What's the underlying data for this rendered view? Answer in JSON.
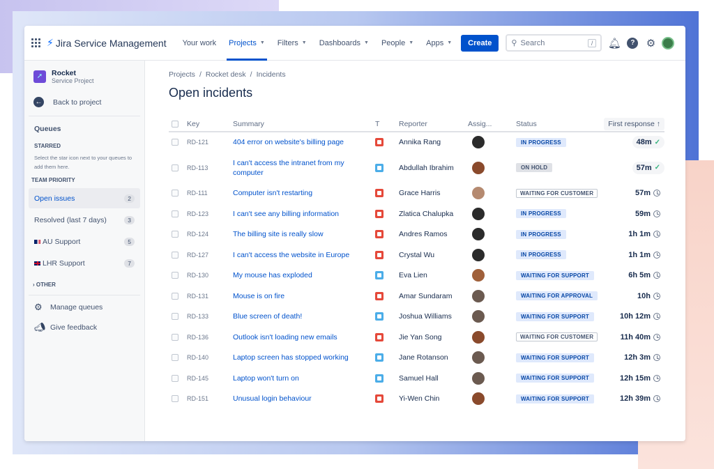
{
  "topbar": {
    "app_name": "Jira Service Management",
    "nav": [
      {
        "label": "Your work",
        "dropdown": false
      },
      {
        "label": "Projects",
        "dropdown": true,
        "active": true
      },
      {
        "label": "Filters",
        "dropdown": true
      },
      {
        "label": "Dashboards",
        "dropdown": true
      },
      {
        "label": "People",
        "dropdown": true
      },
      {
        "label": "Apps",
        "dropdown": true
      }
    ],
    "create_label": "Create",
    "search_placeholder": "Search",
    "search_shortcut": "/"
  },
  "sidebar": {
    "project_name": "Rocket",
    "project_type": "Service Project",
    "back_label": "Back to project",
    "queues_heading": "Queues",
    "starred_heading": "STARRED",
    "starred_hint": "Select the star icon next to your queues to add them here.",
    "team_priority_heading": "TEAM PRIORITY",
    "queues": [
      {
        "label": "Open issues",
        "count": "2",
        "selected": true
      },
      {
        "label": "Resolved (last 7 days)",
        "count": "3"
      },
      {
        "label": "AU Support",
        "count": "5",
        "flag": "au"
      },
      {
        "label": "LHR Support",
        "count": "7",
        "flag": "uk"
      }
    ],
    "other_label": "OTHER",
    "manage_label": "Manage queues",
    "feedback_label": "Give feedback"
  },
  "breadcrumb": [
    "Projects",
    "Rocket desk",
    "Incidents"
  ],
  "page_title": "Open incidents",
  "table": {
    "headers": {
      "key": "Key",
      "summary": "Summary",
      "type": "T",
      "reporter": "Reporter",
      "assignee": "Assig...",
      "status": "Status",
      "first_response": "First response"
    },
    "rows": [
      {
        "key": "RD-121",
        "summary": "404 error on website's billing page",
        "type": "incident",
        "reporter": "Annika Rang",
        "avatar": "#2b2b2b",
        "status": "IN PROGRESS",
        "response": "48m",
        "met": true
      },
      {
        "key": "RD-113",
        "summary": "I can't access the intranet from my computer",
        "type": "service-request",
        "reporter": "Abdullah Ibrahim",
        "avatar": "#8a4a2c",
        "status": "ON HOLD",
        "response": "57m",
        "met": true
      },
      {
        "key": "RD-111",
        "summary": "Computer isn't restarting",
        "type": "incident",
        "reporter": "Grace Harris",
        "avatar": "#b58a70",
        "status": "WAITING FOR CUSTOMER",
        "response": "57m"
      },
      {
        "key": "RD-123",
        "summary": "I can't see any billing information",
        "type": "incident",
        "reporter": "Zlatica Chalupka",
        "avatar": "#2b2b2b",
        "status": "IN PROGRESS",
        "response": "59m"
      },
      {
        "key": "RD-124",
        "summary": "The billing site is really slow",
        "type": "incident",
        "reporter": "Andres Ramos",
        "avatar": "#2b2b2b",
        "status": "IN PROGRESS",
        "response": "1h 1m"
      },
      {
        "key": "RD-127",
        "summary": "I can't access the website in Europe",
        "type": "incident",
        "reporter": "Crystal Wu",
        "avatar": "#2b2b2b",
        "status": "IN PROGRESS",
        "response": "1h 1m"
      },
      {
        "key": "RD-130",
        "summary": "My mouse has exploded",
        "type": "service-request",
        "reporter": "Eva Lien",
        "avatar": "#a0603a",
        "status": "WAITING FOR SUPPORT",
        "response": "6h 5m"
      },
      {
        "key": "RD-131",
        "summary": "Mouse is on fire",
        "type": "incident",
        "reporter": "Amar Sundaram",
        "avatar": "#6b5a50",
        "status": "WAITING FOR APPROVAL",
        "response": "10h"
      },
      {
        "key": "RD-133",
        "summary": "Blue screen of death!",
        "type": "service-request",
        "reporter": "Joshua Williams",
        "avatar": "#6b5a50",
        "status": "WAITING FOR SUPPORT",
        "response": "10h 12m"
      },
      {
        "key": "RD-136",
        "summary": "Outlook isn't loading new emails",
        "type": "incident",
        "reporter": "Jie Yan Song",
        "avatar": "#8a4a2c",
        "status": "WAITING FOR CUSTOMER",
        "response": "11h 40m"
      },
      {
        "key": "RD-140",
        "summary": "Laptop screen has stopped working",
        "type": "service-request",
        "reporter": "Jane Rotanson",
        "avatar": "#6b5a50",
        "status": "WAITING FOR SUPPORT",
        "response": "12h 3m"
      },
      {
        "key": "RD-145",
        "summary": "Laptop won't turn on",
        "type": "service-request",
        "reporter": "Samuel Hall",
        "avatar": "#6b5a50",
        "status": "WAITING FOR SUPPORT",
        "response": "12h 15m"
      },
      {
        "key": "RD-151",
        "summary": "Unusual login behaviour",
        "type": "incident",
        "reporter": "Yi-Wen Chin",
        "avatar": "#8a4a2c",
        "status": "WAITING FOR SUPPORT",
        "response": "12h 39m"
      }
    ]
  },
  "colors": {
    "brand": "#0052cc",
    "incident": "#e5493a",
    "service_request": "#4bade8",
    "in_progress_bg": "#dfe9fc",
    "in_progress_text": "#0747a6",
    "on_hold_bg": "#dfe1e6",
    "met": "#36b37e"
  }
}
